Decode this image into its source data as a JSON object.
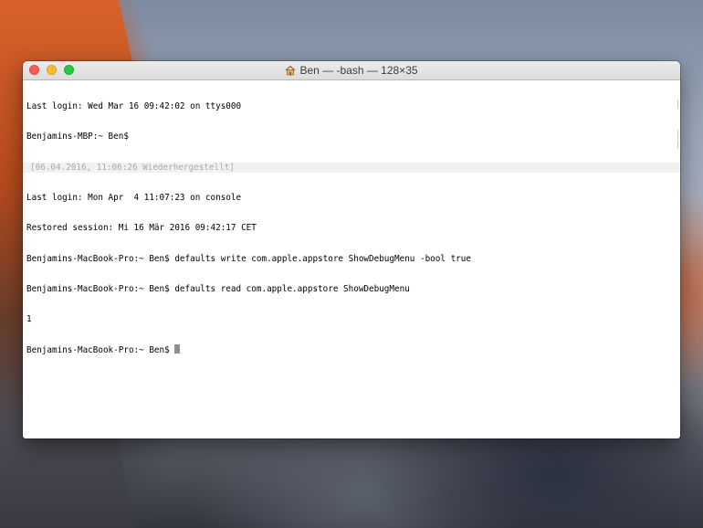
{
  "window": {
    "title": "Ben — -bash — 128×35",
    "icon": "home-icon"
  },
  "terminal": {
    "lines": [
      {
        "text": "Last login: Wed Mar 16 09:42:02 on ttys000",
        "style": "normal"
      },
      {
        "text": "Benjamins-MBP:~ Ben$",
        "style": "normal"
      },
      {
        "text": "[06.04.2016, 11:06:26 Wiederhergestellt]",
        "style": "restored"
      },
      {
        "text": "Last login: Mon Apr  4 11:07:23 on console",
        "style": "normal"
      },
      {
        "text": "Restored session: Mi 16 Mär 2016 09:42:17 CET",
        "style": "normal"
      },
      {
        "text": "Benjamins-MacBook-Pro:~ Ben$ defaults write com.apple.appstore ShowDebugMenu -bool true",
        "style": "normal"
      },
      {
        "text": "Benjamins-MacBook-Pro:~ Ben$ defaults read com.apple.appstore ShowDebugMenu",
        "style": "normal"
      },
      {
        "text": "1",
        "style": "normal"
      },
      {
        "text": "Benjamins-MacBook-Pro:~ Ben$ ",
        "style": "prompt"
      }
    ]
  },
  "colors": {
    "close": "#fc5f57",
    "minimize": "#fdbc2e",
    "maximize": "#28c840",
    "cursor": "#8e8e8e"
  }
}
